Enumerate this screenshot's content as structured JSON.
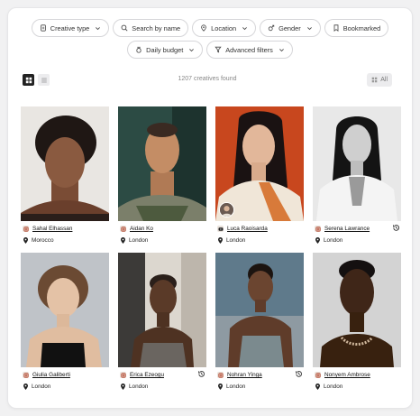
{
  "filters": {
    "row1": [
      {
        "key": "creative_type",
        "label": "Creative type",
        "icon": "document-icon",
        "dropdown": true
      },
      {
        "key": "search",
        "label": "Search by name",
        "icon": "search-icon",
        "dropdown": false
      },
      {
        "key": "location",
        "label": "Location",
        "icon": "location-icon",
        "dropdown": true
      },
      {
        "key": "gender",
        "label": "Gender",
        "icon": "gender-icon",
        "dropdown": true
      },
      {
        "key": "bookmarked",
        "label": "Bookmarked",
        "icon": "bookmark-icon",
        "dropdown": false
      }
    ],
    "row2": [
      {
        "key": "daily_budget",
        "label": "Daily budget",
        "icon": "money-bag-icon",
        "dropdown": true
      },
      {
        "key": "advanced",
        "label": "Advanced filters",
        "icon": "funnel-icon",
        "dropdown": true
      }
    ]
  },
  "toolbar": {
    "results_count": "1207 creatives found",
    "view_modes": [
      "grid",
      "list"
    ],
    "active_view": "grid",
    "all_label": "All"
  },
  "creatives": [
    {
      "name": "Sahal Elhassan",
      "location": "Morocco",
      "platform": "instagram-icon",
      "history": false,
      "avatar_badge": false
    },
    {
      "name": "Aidan Ko",
      "location": "London",
      "platform": "instagram-icon",
      "history": false,
      "avatar_badge": false
    },
    {
      "name": "Luca Raoisarda",
      "location": "London",
      "platform": "youtube-icon",
      "history": false,
      "avatar_badge": true
    },
    {
      "name": "Serena Lawrance",
      "location": "London",
      "platform": "instagram-icon",
      "history": true,
      "avatar_badge": false
    },
    {
      "name": "Giulia Galiberti",
      "location": "London",
      "platform": "instagram-icon",
      "history": false,
      "avatar_badge": false
    },
    {
      "name": "Erica Ezeogu",
      "location": "London",
      "platform": "instagram-icon",
      "history": true,
      "avatar_badge": false
    },
    {
      "name": "Nohran Yinga",
      "location": "London",
      "platform": "instagram-icon",
      "history": true,
      "avatar_badge": false
    },
    {
      "name": "Nonyem Ambrose",
      "location": "London",
      "platform": "instagram-icon",
      "history": false,
      "avatar_badge": false
    }
  ],
  "colors": {
    "pill_border": "#d6d6d9",
    "active_toggle": "#222222",
    "photo_backgrounds": [
      "#e9e6e2",
      "#2c4b44",
      "#c8471e",
      "#e8e8e8",
      "#c7c9cc",
      "#dcd7cf",
      "#5f7a8b",
      "#d3d3d3"
    ]
  }
}
